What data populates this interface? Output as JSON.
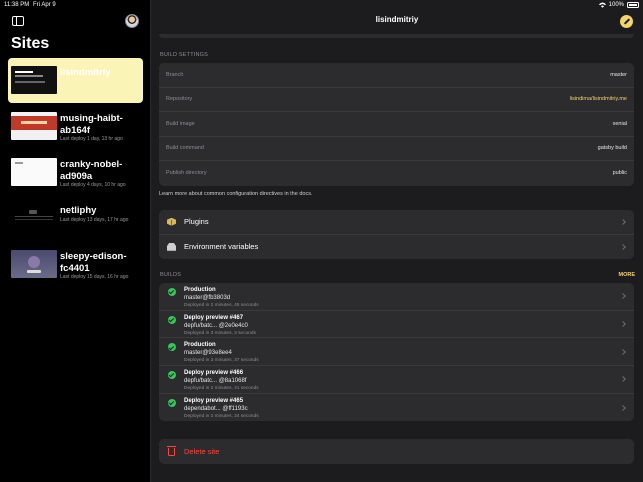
{
  "status": {
    "time": "11:38 PM",
    "date": "Fri Apr 9",
    "battery": "100%"
  },
  "sidebar": {
    "title": "Sites",
    "items": [
      {
        "name": "lisindmitriy",
        "meta": "",
        "thumb": "t0",
        "active": true
      },
      {
        "name": "musing-haibt-ab164f",
        "meta": "Last deploy 1 day, 13 hr ago",
        "thumb": "t1"
      },
      {
        "name": "cranky-nobel-ad909a",
        "meta": "Last deploy 4 days, 10 hr ago",
        "thumb": "t2"
      },
      {
        "name": "netliphy",
        "meta": "Last deploy 13 days, 17 hr ago",
        "thumb": "t3"
      },
      {
        "name": "sleepy-edison-fc4401",
        "meta": "Last deploy 15 days, 16 hr ago",
        "thumb": "t4"
      }
    ]
  },
  "header": {
    "title": "lisindmitriy"
  },
  "build_settings": {
    "label": "BUILD SETTINGS",
    "rows": [
      {
        "key": "Branch",
        "value": "master"
      },
      {
        "key": "Repository",
        "value": "lisindima/lisindmitriy.me"
      },
      {
        "key": "Build image",
        "value": "xenial"
      },
      {
        "key": "Build command",
        "value": "gatsby build"
      },
      {
        "key": "Publish directory",
        "value": "public"
      }
    ],
    "hint": "Learn more about common configuration directives in the docs."
  },
  "menu": {
    "plugins": "Plugins",
    "env": "Environment variables"
  },
  "builds": {
    "label": "BUILDS",
    "more": "MORE",
    "items": [
      {
        "title": "Production",
        "sub": "master@fb3803d",
        "meta": "Deployed in 2 minutes, 45 seconds"
      },
      {
        "title": "Deploy preview  #467",
        "sub": "depfu/batc... @2e0e4c0",
        "meta": "Deployed in 3 minutes, 3 seconds"
      },
      {
        "title": "Production",
        "sub": "master@93e8ee4",
        "meta": "Deployed in 2 minutes, 37 seconds"
      },
      {
        "title": "Deploy preview  #466",
        "sub": "depfu/batc... @8a1068f",
        "meta": "Deployed in 2 minutes, 41 seconds"
      },
      {
        "title": "Deploy preview  #465",
        "sub": "dependabot... @ff1193c",
        "meta": "Deployed in 2 minutes, 34 seconds"
      }
    ]
  },
  "delete": {
    "label": "Delete site"
  }
}
